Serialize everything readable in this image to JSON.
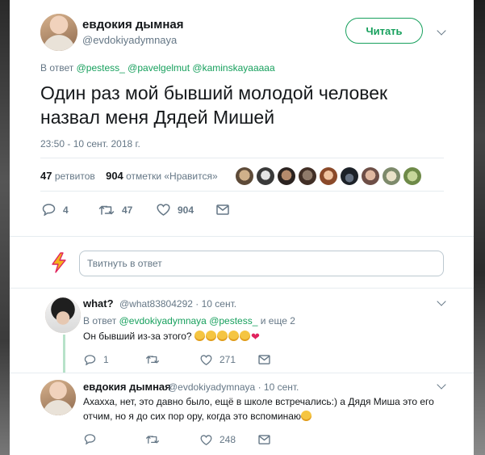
{
  "tweet": {
    "author_name": "евдокия дымная",
    "author_handle": "@evdokiyadymnaya",
    "follow_label": "Читать",
    "reply_prefix": "В ответ",
    "reply_mentions": [
      "@pestess_",
      "@pavelgelmut",
      "@kaminskayaaaaa"
    ],
    "text": "Один раз мой бывший молодой человек назвал меня Дядей Мишей",
    "timestamp": "23:50 - 10 сент. 2018 г.",
    "retweets_count": "47",
    "retweets_label": "ретвитов",
    "likes_count": "904",
    "likes_label": "отметки «Нравится»",
    "actions": {
      "reply": "4",
      "retweet": "47",
      "like": "904"
    }
  },
  "compose": {
    "placeholder": "Твитнуть в ответ"
  },
  "replies": [
    {
      "name": "what?",
      "handle": "@what83804292",
      "date": "· 10 сент.",
      "reply_prefix": "В ответ",
      "mentions": [
        "@evdokiyadymnaya",
        "@pestess_"
      ],
      "reply_suffix": "и еще 2",
      "text": "Он бывший из-за этого?",
      "actions": {
        "reply": "1",
        "retweet": "",
        "like": "271"
      }
    },
    {
      "name": "евдокия дымная",
      "handle": "@evdokiyadymnaya",
      "date": "· 10 сент.",
      "text_line1": "Ахахха, нет, это давно было, ещё в школе встречались:) а Дядя Миша это его",
      "text_line2": "отчим, но я до сих пор ору, когда это вспоминаю",
      "actions": {
        "reply": "",
        "retweet": "",
        "like": "248"
      }
    }
  ],
  "icons": [
    "reply-icon",
    "retweet-icon",
    "heart-icon",
    "mail-icon",
    "chevron-down-icon",
    "lightning-icon"
  ],
  "colors": {
    "accent": "#17a05d",
    "muted": "#657786",
    "text": "#14171a",
    "like": "#e0245e"
  }
}
